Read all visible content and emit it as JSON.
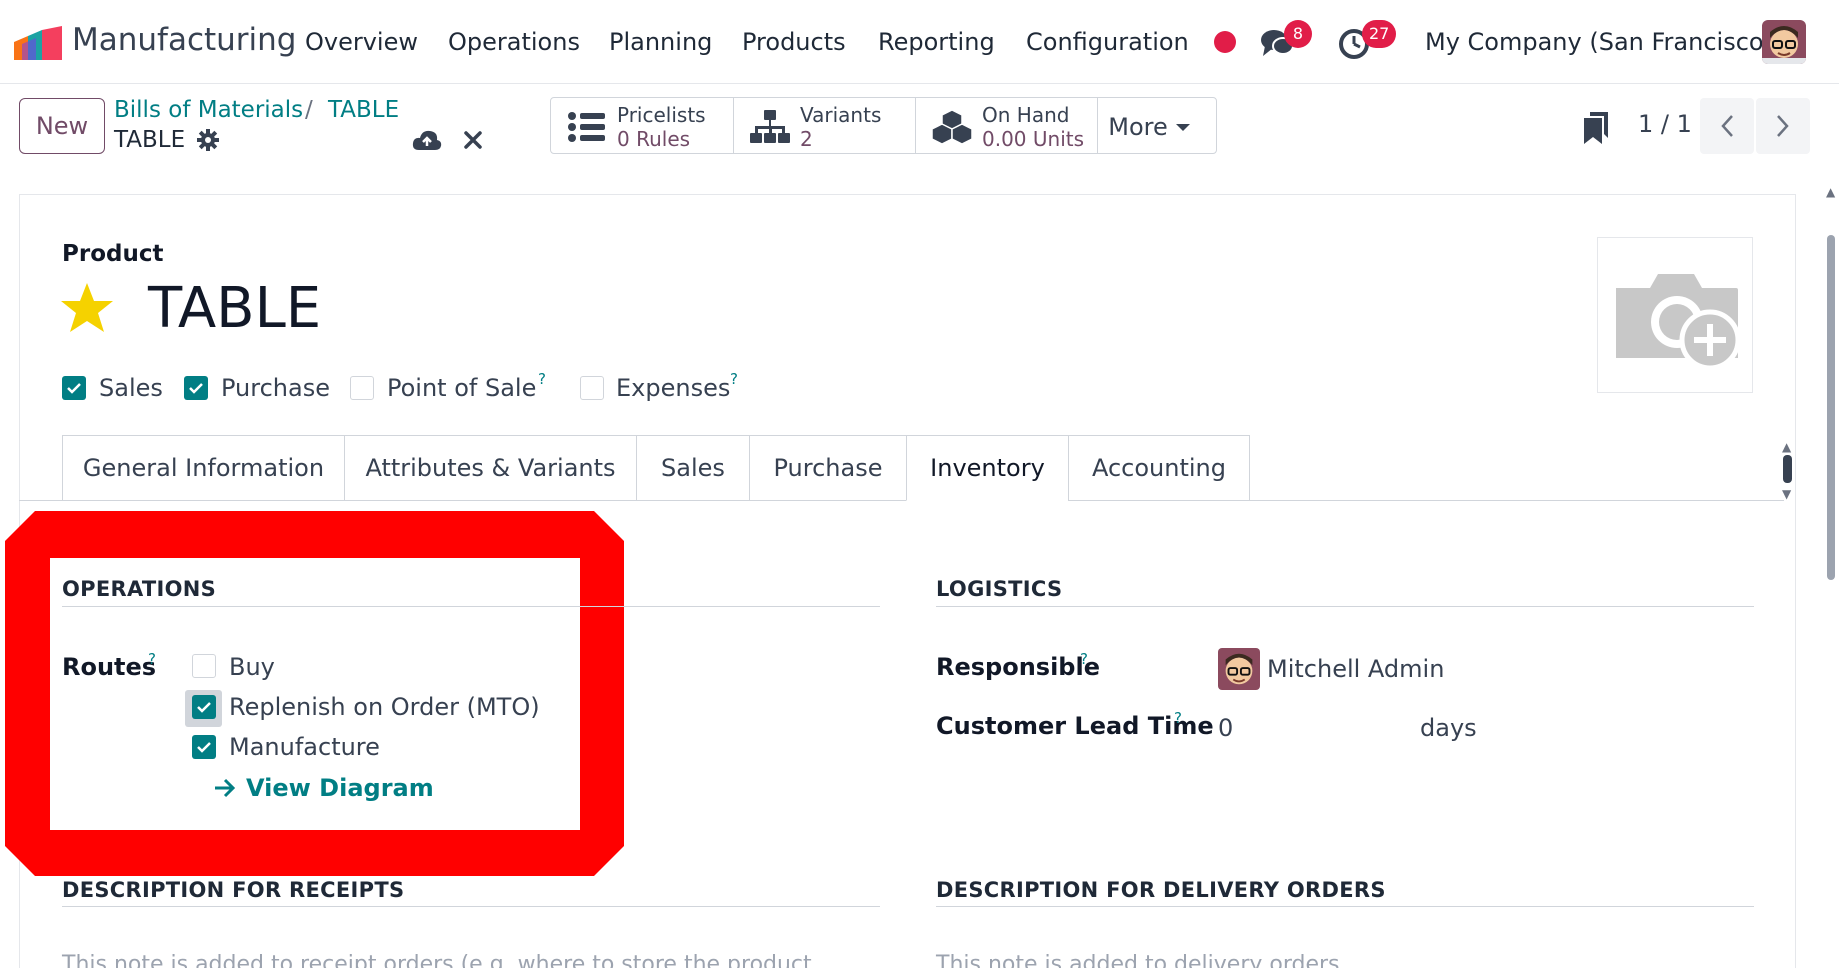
{
  "app": {
    "name": "Manufacturing",
    "menu": [
      "Overview",
      "Operations",
      "Planning",
      "Products",
      "Reporting",
      "Configuration"
    ],
    "messages_count": "8",
    "activities_count": "27",
    "company": "My Company (San Francisco)"
  },
  "control_panel": {
    "new_label": "New",
    "breadcrumb_parent": "Bills of Materials",
    "breadcrumb_separator": "/",
    "breadcrumb_current": "TABLE",
    "record_name": "TABLE",
    "smart_buttons": [
      {
        "title": "Pricelists",
        "value": "0 Rules",
        "icon": "list-icon"
      },
      {
        "title": "Variants",
        "value": "2",
        "icon": "sitemap-icon"
      },
      {
        "title": "On Hand",
        "value": "0.00 Units",
        "icon": "cubes-icon"
      }
    ],
    "more_label": "More",
    "pager": "1 / 1"
  },
  "product": {
    "label": "Product",
    "name": "TABLE",
    "options": [
      {
        "label": "Sales",
        "checked": true,
        "help": ""
      },
      {
        "label": "Purchase",
        "checked": true,
        "help": ""
      },
      {
        "label": "Point of Sale",
        "checked": false,
        "help": "?"
      },
      {
        "label": "Expenses",
        "checked": false,
        "help": "?"
      }
    ]
  },
  "tabs": [
    "General Information",
    "Attributes & Variants",
    "Sales",
    "Purchase",
    "Inventory",
    "Accounting"
  ],
  "active_tab": "Inventory",
  "operations": {
    "title": "OPERATIONS",
    "routes_label": "Routes",
    "routes_help": "?",
    "routes": [
      {
        "label": "Buy",
        "checked": false
      },
      {
        "label": "Replenish on Order (MTO)",
        "checked": true
      },
      {
        "label": "Manufacture",
        "checked": true
      }
    ],
    "view_diagram": "View Diagram"
  },
  "logistics": {
    "title": "LOGISTICS",
    "responsible_label": "Responsible",
    "responsible_help": "?",
    "responsible_value": "Mitchell Admin",
    "lead_time_label": "Customer Lead Time",
    "lead_time_help": "?",
    "lead_time_value": "0",
    "lead_time_unit": "days"
  },
  "descriptions": {
    "receipts_title": "DESCRIPTION FOR RECEIPTS",
    "receipts_placeholder": "This note is added to receipt orders (e.g. where to store the product",
    "delivery_title": "DESCRIPTION FOR DELIVERY ORDERS",
    "delivery_placeholder": "This note is added to delivery orders."
  },
  "colors": {
    "accent": "#017e84",
    "brand": "#714b67",
    "badge": "#e11d48",
    "highlight": "#ff0000",
    "star": "#f5d200"
  }
}
